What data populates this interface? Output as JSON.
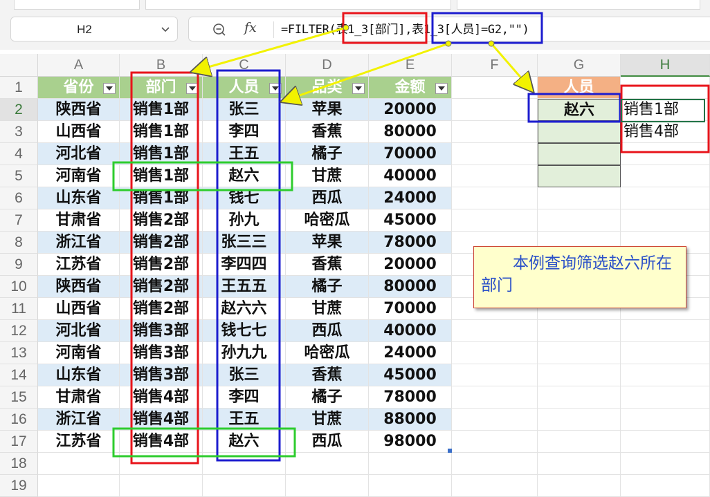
{
  "name_box": {
    "value": "H2"
  },
  "formula": {
    "text": "=FILTER(表1_3[部门],表1_3[人员]=G2,\"\")"
  },
  "columns": [
    "A",
    "B",
    "C",
    "D",
    "E",
    "F",
    "G",
    "H"
  ],
  "rows": [
    "1",
    "2",
    "3",
    "4",
    "5",
    "6",
    "7",
    "8",
    "9",
    "10",
    "11",
    "12",
    "13",
    "14",
    "15",
    "16",
    "17",
    "18",
    "19"
  ],
  "table": {
    "headers": [
      "省份",
      "部门",
      "人员",
      "品类",
      "金额"
    ],
    "rows": [
      [
        "陕西省",
        "销售1部",
        "张三",
        "苹果",
        "20000"
      ],
      [
        "山西省",
        "销售1部",
        "李四",
        "香蕉",
        "80000"
      ],
      [
        "河北省",
        "销售1部",
        "王五",
        "橘子",
        "70000"
      ],
      [
        "河南省",
        "销售1部",
        "赵六",
        "甘蔗",
        "40000"
      ],
      [
        "山东省",
        "销售1部",
        "钱七",
        "西瓜",
        "24000"
      ],
      [
        "甘肃省",
        "销售2部",
        "孙九",
        "哈密瓜",
        "45000"
      ],
      [
        "浙江省",
        "销售2部",
        "张三三",
        "苹果",
        "78000"
      ],
      [
        "江苏省",
        "销售2部",
        "李四四",
        "香蕉",
        "20000"
      ],
      [
        "陕西省",
        "销售2部",
        "王五五",
        "橘子",
        "80000"
      ],
      [
        "山西省",
        "销售2部",
        "赵六六",
        "甘蔗",
        "70000"
      ],
      [
        "河北省",
        "销售3部",
        "钱七七",
        "西瓜",
        "40000"
      ],
      [
        "河南省",
        "销售3部",
        "孙九九",
        "哈密瓜",
        "24000"
      ],
      [
        "山东省",
        "销售3部",
        "张三",
        "香蕉",
        "45000"
      ],
      [
        "甘肃省",
        "销售4部",
        "李四",
        "橘子",
        "78000"
      ],
      [
        "浙江省",
        "销售4部",
        "王五",
        "甘蔗",
        "88000"
      ],
      [
        "江苏省",
        "销售4部",
        "赵六",
        "西瓜",
        "98000"
      ]
    ]
  },
  "lookup": {
    "header": "人员",
    "value": "赵六"
  },
  "results": [
    "销售1部",
    "销售4部"
  ],
  "note": {
    "text": "本例查询筛选赵六所在部门"
  },
  "colors": {
    "table_header": "#a9d08e",
    "band": "#ddebf7",
    "lookup_header": "#f4b084",
    "lookup_cell": "#e2efda",
    "box_red": "#e8141b",
    "box_blue": "#1c1ccf",
    "box_green": "#2ecc2e",
    "arrow_yellow": "#f2f200",
    "note_text": "#2a50c8"
  }
}
